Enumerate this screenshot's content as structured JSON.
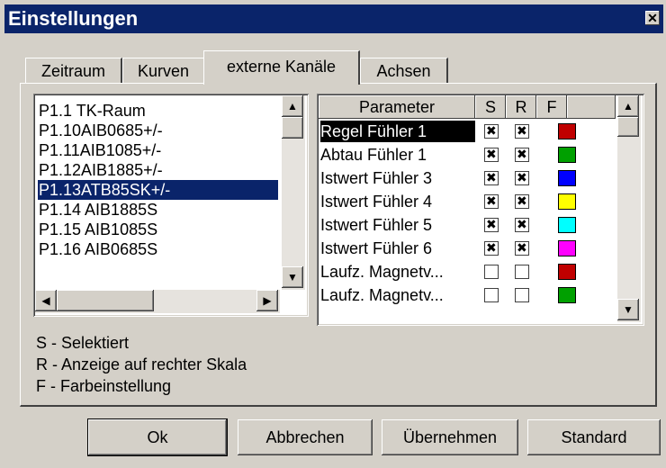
{
  "window": {
    "title": "Einstellungen",
    "close_glyph": "✕"
  },
  "tabs": [
    {
      "label": "Zeitraum",
      "active": false
    },
    {
      "label": "Kurven",
      "active": false
    },
    {
      "label": "externe Kanäle",
      "active": true
    },
    {
      "label": "Achsen",
      "active": false
    }
  ],
  "channel_list": {
    "items": [
      "P1.1 TK-Raum",
      "P1.10AIB0685+/-",
      "P1.11AIB1085+/-",
      "P1.12AIB1885+/-",
      "P1.13ATB85SK+/-",
      "P1.14 AIB1885S",
      "P1.15 AIB1085S",
      "P1.16 AIB0685S"
    ],
    "selected_index": 4
  },
  "param_table": {
    "headers": [
      "Parameter",
      "S",
      "R",
      "F"
    ],
    "rows": [
      {
        "name": "Regel Fühler 1",
        "s": true,
        "r": true,
        "color": "#c00000",
        "selected": true
      },
      {
        "name": "Abtau Fühler 1",
        "s": true,
        "r": true,
        "color": "#00a000",
        "selected": false
      },
      {
        "name": "Istwert Fühler 3",
        "s": true,
        "r": true,
        "color": "#0000ff",
        "selected": false
      },
      {
        "name": "Istwert Fühler 4",
        "s": true,
        "r": true,
        "color": "#ffff00",
        "selected": false
      },
      {
        "name": "Istwert Fühler 5",
        "s": true,
        "r": true,
        "color": "#00ffff",
        "selected": false
      },
      {
        "name": "Istwert Fühler 6",
        "s": true,
        "r": true,
        "color": "#ff00ff",
        "selected": false
      },
      {
        "name": "Laufz. Magnetv...",
        "s": false,
        "r": false,
        "color": "#c00000",
        "selected": false
      },
      {
        "name": "Laufz. Magnetv...",
        "s": false,
        "r": false,
        "color": "#00a000",
        "selected": false
      }
    ]
  },
  "legend": [
    "S - Selektiert",
    "R - Anzeige auf rechter Skala",
    "F - Farbeinstellung"
  ],
  "buttons": {
    "ok": "Ok",
    "cancel": "Abbrechen",
    "apply": "Übernehmen",
    "standard": "Standard"
  },
  "icons": {
    "scroll_up": "▲",
    "scroll_down": "▼",
    "scroll_left": "◀",
    "scroll_right": "▶",
    "check": "✖"
  }
}
